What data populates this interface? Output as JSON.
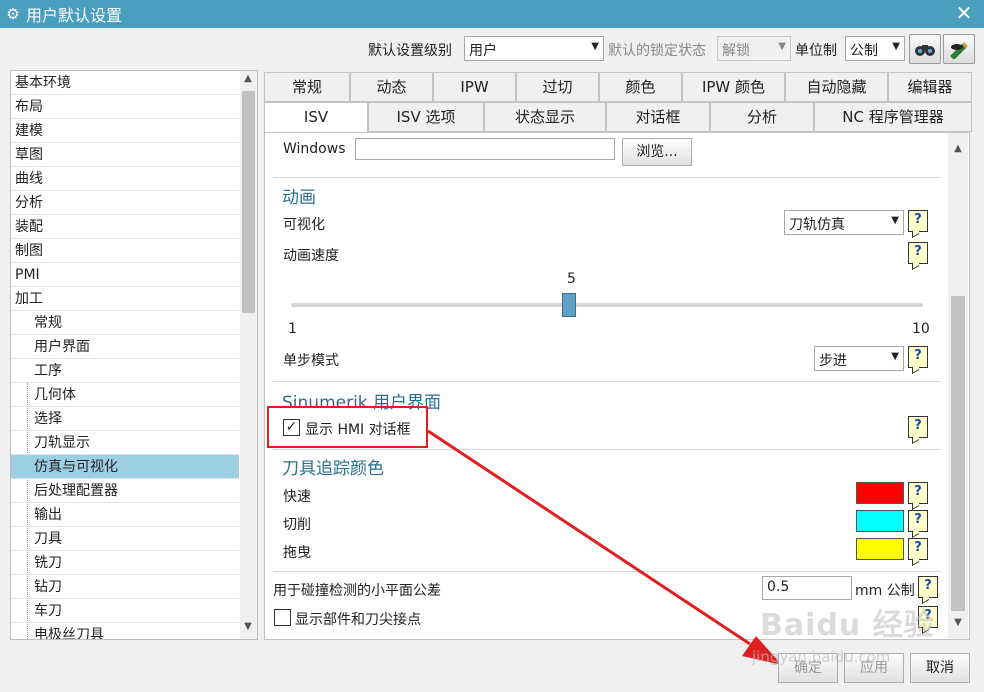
{
  "window": {
    "title": "用户默认设置",
    "close_glyph": "✕",
    "gear_glyph": "⚙"
  },
  "topbar": {
    "level_label": "默认设置级别",
    "level_value": "用户",
    "lock_label": "默认的锁定状态",
    "lock_value": "解锁",
    "unit_label": "单位制",
    "unit_value": "公制"
  },
  "tree": {
    "top_items": [
      "基本环境",
      "布局",
      "建模",
      "草图",
      "曲线",
      "分析",
      "装配",
      "制图",
      "PMI",
      "加工"
    ],
    "child_items": [
      "常规",
      "用户界面",
      "工序",
      "几何体",
      "选择",
      "刀轨显示",
      "仿真与可视化",
      "后处理配置器",
      "输出",
      "刀具",
      "铣刀",
      "钻刀",
      "车刀",
      "电极丝刀具"
    ],
    "selected_child": "仿真与可视化"
  },
  "tabs_row1": [
    "常规",
    "动态",
    "IPW",
    "过切",
    "颜色",
    "IPW 颜色",
    "自动隐藏",
    "编辑器"
  ],
  "tabs_row2": [
    "ISV",
    "ISV 选项",
    "状态显示",
    "对话框",
    "分析",
    "NC 程序管理器"
  ],
  "active_tab": "ISV",
  "content": {
    "windows_label": "Windows",
    "windows_value": "",
    "browse_button": "浏览...",
    "animation": {
      "title": "动画",
      "visualize_label": "可视化",
      "visualize_value": "刀轨仿真",
      "speed_label": "动画速度",
      "speed_value": "5",
      "speed_min": "1",
      "speed_max": "10",
      "speed_fraction": 0.44,
      "step_label": "单步模式",
      "step_value": "步进"
    },
    "sinumerik": {
      "title": "Sinumerik 用户界面",
      "show_hmi_label": "显示 HMI 对话框",
      "show_hmi_checked": true
    },
    "trace_colors": {
      "title": "刀具追踪颜色",
      "items": [
        {
          "label": "快速",
          "color": "#ff0000"
        },
        {
          "label": "切削",
          "color": "#00ffff"
        },
        {
          "label": "拖曳",
          "color": "#ffff00"
        }
      ]
    },
    "tolerance_label": "用于碰撞检测的小平面公差",
    "tolerance_value": "0.5",
    "tolerance_unit": "mm 公制",
    "show_contacts_label": "显示部件和刀尖接点",
    "show_contacts_checked": false,
    "help_glyph": "?"
  },
  "footer": {
    "ok": "确定",
    "apply": "应用",
    "cancel": "取消"
  },
  "watermark": {
    "brand": "Baidu 经验",
    "url": "jingyan.baidu.com"
  },
  "checkmark_glyph": "✓",
  "dropdown_glyph": "▼"
}
